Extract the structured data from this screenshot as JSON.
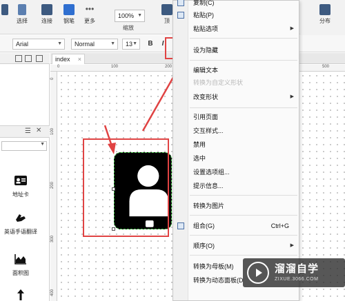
{
  "toolbar": {
    "select_label": "选择",
    "connect_label": "连接",
    "pen_label": "钢笔",
    "more_label": "更多",
    "zoom_value": "100%",
    "zoom_caption": "缩放",
    "partial_label": "顶",
    "distribute_label": "分布"
  },
  "formatbar": {
    "font_family": "Arial",
    "font_style": "Normal",
    "font_size": "13",
    "bold": "B",
    "italic": "I"
  },
  "tabs": [
    {
      "label": "index",
      "close": "×"
    }
  ],
  "ruler": {
    "h_ticks": [
      "0",
      "100",
      "200",
      "500"
    ],
    "v_ticks": [
      "0",
      "100",
      "200",
      "300",
      "400"
    ]
  },
  "widgets": [
    {
      "label": "地址卡",
      "icon": "address-card-icon"
    },
    {
      "label": "英语手语翻译",
      "icon": "sign-language-icon"
    },
    {
      "label": "面积图",
      "icon": "area-chart-icon"
    },
    {
      "label": "",
      "icon": "arrow-up-icon"
    }
  ],
  "context_menu": {
    "items": [
      {
        "label": "复制(C)",
        "shortcut": "",
        "submenu": false,
        "disabled": false
      },
      {
        "label": "粘贴(P)",
        "shortcut": "",
        "submenu": false,
        "disabled": false
      },
      {
        "label": "粘贴选项",
        "shortcut": "",
        "submenu": true,
        "disabled": false
      },
      {
        "label": "设为隐藏",
        "shortcut": "",
        "submenu": false,
        "disabled": false
      },
      {
        "label": "编辑文本",
        "shortcut": "",
        "submenu": false,
        "disabled": false
      },
      {
        "label": "转换为自定义形状",
        "shortcut": "",
        "submenu": false,
        "disabled": true
      },
      {
        "label": "改变形状",
        "shortcut": "",
        "submenu": true,
        "disabled": false
      },
      {
        "label": "引用页面",
        "shortcut": "",
        "submenu": false,
        "disabled": false
      },
      {
        "label": "交互样式...",
        "shortcut": "",
        "submenu": false,
        "disabled": false
      },
      {
        "label": "禁用",
        "shortcut": "",
        "submenu": false,
        "disabled": false
      },
      {
        "label": "选中",
        "shortcut": "",
        "submenu": false,
        "disabled": false
      },
      {
        "label": "设置选项组...",
        "shortcut": "",
        "submenu": false,
        "disabled": false
      },
      {
        "label": "提示信息...",
        "shortcut": "",
        "submenu": false,
        "disabled": false
      },
      {
        "label": "转换为图片",
        "shortcut": "",
        "submenu": false,
        "disabled": false
      },
      {
        "label": "组合(G)",
        "shortcut": "Ctrl+G",
        "submenu": false,
        "disabled": false
      },
      {
        "label": "顺序(O)",
        "shortcut": "",
        "submenu": true,
        "disabled": false
      },
      {
        "label": "转换为母板(M)",
        "shortcut": "",
        "submenu": false,
        "disabled": false
      },
      {
        "label": "转换为动态面板(D",
        "shortcut": "",
        "submenu": false,
        "disabled": false
      }
    ],
    "submenu_arrow": "▶"
  },
  "annotation_color": "#e04343",
  "watermark": {
    "title": "溜溜自学",
    "url": "ZIXUE.3066.COM"
  }
}
